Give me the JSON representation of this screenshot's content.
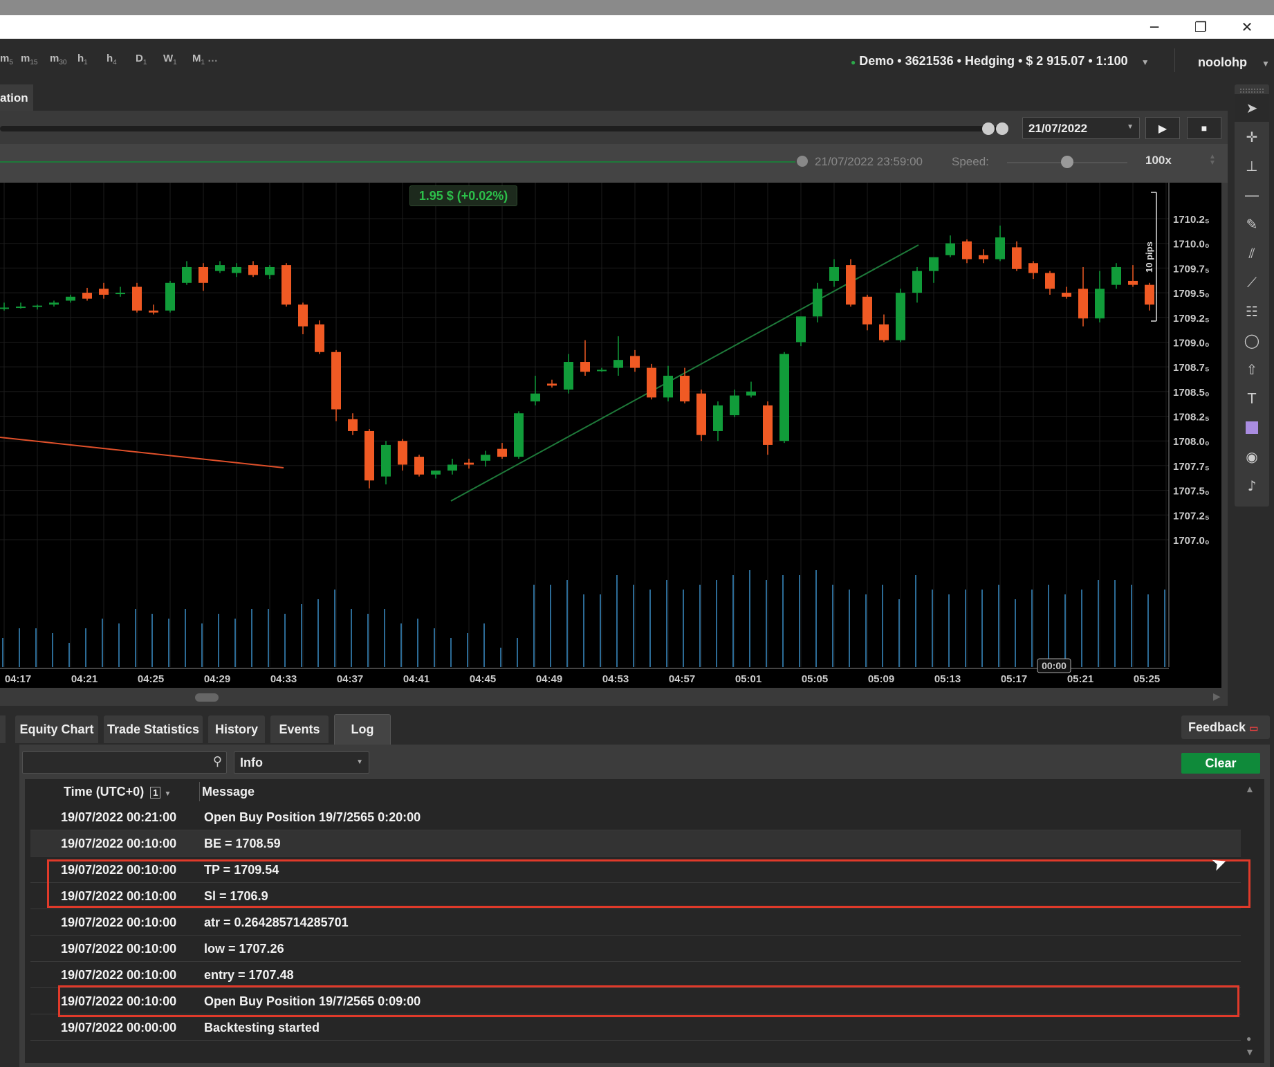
{
  "window": {
    "minimize": "─",
    "restore": "❐",
    "close": "✕"
  },
  "timeframes": [
    {
      "main": "m",
      "sub": "5"
    },
    {
      "main": "m",
      "sub": "15"
    },
    {
      "main": "m",
      "sub": "30"
    },
    {
      "main": "h",
      "sub": "1"
    },
    {
      "main": "h",
      "sub": "4"
    },
    {
      "main": "D",
      "sub": "1"
    },
    {
      "main": "W",
      "sub": "1"
    },
    {
      "main": "M",
      "sub": "1"
    }
  ],
  "more": "…",
  "account": {
    "status_color": "#2ca84a",
    "text": "Demo • 3621536 • Hedging • $ 2 915.07 • 1:100",
    "user": "noolohp"
  },
  "tab": {
    "label": "ation"
  },
  "controls": {
    "date": "21/07/2022",
    "end_time": "21/07/2022 23:59:00",
    "speed_label": "Speed:",
    "speed_value": "100x",
    "speed_level": 0.5
  },
  "chart_data": {
    "type": "candlestick",
    "profit_label": "1.95 $ (+0.02%)",
    "pips_label": "10 pips",
    "y_ticks": [
      "1710.2₅",
      "1710.0₀",
      "1709.7₅",
      "1709.5₀",
      "1709.2₅",
      "1709.0₀",
      "1708.7₅",
      "1708.5₀",
      "1708.2₅",
      "1708.0₀",
      "1707.7₅",
      "1707.5₀",
      "1707.2₅",
      "1707.0₀"
    ],
    "y_values": [
      1710.25,
      1710.0,
      1709.75,
      1709.5,
      1709.25,
      1709.0,
      1708.75,
      1708.5,
      1708.25,
      1708.0,
      1707.75,
      1707.5,
      1707.25,
      1707.0
    ],
    "x_ticks": [
      "04:17",
      "04:21",
      "04:25",
      "04:29",
      "04:33",
      "04:37",
      "04:41",
      "04:45",
      "04:49",
      "04:53",
      "04:57",
      "05:01",
      "05:05",
      "05:09",
      "05:13",
      "05:17",
      "05:21",
      "05:25"
    ],
    "cursor_time": "00:00",
    "candles": [
      [
        1709.35,
        1709.4,
        1709.32,
        1709.35
      ],
      [
        1709.36,
        1709.4,
        1709.34,
        1709.36
      ],
      [
        1709.36,
        1709.38,
        1709.33,
        1709.37
      ],
      [
        1709.38,
        1709.42,
        1709.36,
        1709.4
      ],
      [
        1709.42,
        1709.48,
        1709.4,
        1709.46
      ],
      [
        1709.5,
        1709.55,
        1709.42,
        1709.44
      ],
      [
        1709.54,
        1709.6,
        1709.44,
        1709.48
      ],
      [
        1709.5,
        1709.56,
        1709.46,
        1709.5
      ],
      [
        1709.56,
        1709.6,
        1709.3,
        1709.32
      ],
      [
        1709.32,
        1709.38,
        1709.28,
        1709.3
      ],
      [
        1709.32,
        1709.62,
        1709.3,
        1709.6
      ],
      [
        1709.6,
        1709.82,
        1709.58,
        1709.76
      ],
      [
        1709.76,
        1709.8,
        1709.52,
        1709.6
      ],
      [
        1709.72,
        1709.82,
        1709.7,
        1709.78
      ],
      [
        1709.7,
        1709.8,
        1709.66,
        1709.76
      ],
      [
        1709.78,
        1709.82,
        1709.66,
        1709.68
      ],
      [
        1709.68,
        1709.78,
        1709.64,
        1709.76
      ],
      [
        1709.78,
        1709.8,
        1709.36,
        1709.38
      ],
      [
        1709.38,
        1709.4,
        1709.08,
        1709.16
      ],
      [
        1709.18,
        1709.22,
        1708.88,
        1708.9
      ],
      [
        1708.9,
        1708.92,
        1708.2,
        1708.32
      ],
      [
        1708.22,
        1708.28,
        1708.06,
        1708.1
      ],
      [
        1708.1,
        1708.12,
        1707.52,
        1707.6
      ],
      [
        1707.64,
        1708.0,
        1707.56,
        1707.96
      ],
      [
        1708.0,
        1708.02,
        1707.7,
        1707.76
      ],
      [
        1707.84,
        1707.86,
        1707.64,
        1707.66
      ],
      [
        1707.66,
        1707.7,
        1707.62,
        1707.7
      ],
      [
        1707.7,
        1707.82,
        1707.66,
        1707.76
      ],
      [
        1707.78,
        1707.82,
        1707.72,
        1707.76
      ],
      [
        1707.8,
        1707.9,
        1707.74,
        1707.86
      ],
      [
        1707.92,
        1707.98,
        1707.82,
        1707.84
      ],
      [
        1707.84,
        1708.3,
        1707.82,
        1708.28
      ],
      [
        1708.4,
        1708.66,
        1708.36,
        1708.48
      ],
      [
        1708.58,
        1708.62,
        1708.54,
        1708.56
      ],
      [
        1708.52,
        1708.88,
        1708.48,
        1708.8
      ],
      [
        1708.8,
        1709.02,
        1708.66,
        1708.7
      ],
      [
        1708.72,
        1708.74,
        1708.7,
        1708.72
      ],
      [
        1708.74,
        1709.06,
        1708.66,
        1708.82
      ],
      [
        1708.86,
        1708.92,
        1708.7,
        1708.74
      ],
      [
        1708.74,
        1708.78,
        1708.42,
        1708.44
      ],
      [
        1708.44,
        1708.76,
        1708.4,
        1708.66
      ],
      [
        1708.66,
        1708.74,
        1708.38,
        1708.4
      ],
      [
        1708.48,
        1708.52,
        1708.0,
        1708.06
      ],
      [
        1708.1,
        1708.4,
        1708.0,
        1708.36
      ],
      [
        1708.26,
        1708.52,
        1708.24,
        1708.46
      ],
      [
        1708.46,
        1708.6,
        1708.44,
        1708.5
      ],
      [
        1708.36,
        1708.4,
        1707.86,
        1707.96
      ],
      [
        1708.0,
        1708.9,
        1707.98,
        1708.88
      ],
      [
        1709.0,
        1709.26,
        1708.96,
        1709.26
      ],
      [
        1709.26,
        1709.6,
        1709.2,
        1709.54
      ],
      [
        1709.62,
        1709.84,
        1709.56,
        1709.76
      ],
      [
        1709.78,
        1709.84,
        1709.36,
        1709.38
      ],
      [
        1709.46,
        1709.48,
        1709.12,
        1709.18
      ],
      [
        1709.18,
        1709.28,
        1709.0,
        1709.02
      ],
      [
        1709.02,
        1709.54,
        1709.0,
        1709.5
      ],
      [
        1709.5,
        1709.76,
        1709.4,
        1709.72
      ],
      [
        1709.72,
        1709.82,
        1709.6,
        1709.86
      ],
      [
        1709.88,
        1710.08,
        1709.86,
        1710.0
      ],
      [
        1710.02,
        1710.04,
        1709.8,
        1709.84
      ],
      [
        1709.88,
        1709.94,
        1709.8,
        1709.84
      ],
      [
        1709.84,
        1710.18,
        1709.82,
        1710.06
      ],
      [
        1709.96,
        1710.02,
        1709.72,
        1709.74
      ],
      [
        1709.8,
        1709.82,
        1709.64,
        1709.7
      ],
      [
        1709.7,
        1709.72,
        1709.48,
        1709.54
      ],
      [
        1709.5,
        1709.56,
        1709.44,
        1709.46
      ],
      [
        1709.54,
        1709.76,
        1709.16,
        1709.24
      ],
      [
        1709.24,
        1709.72,
        1709.2,
        1709.54
      ],
      [
        1709.58,
        1709.8,
        1709.54,
        1709.76
      ],
      [
        1709.62,
        1709.78,
        1709.56,
        1709.58
      ],
      [
        1709.58,
        1709.6,
        1709.32,
        1709.38
      ],
      [
        1709.28,
        1709.5,
        1709.24,
        1709.46
      ],
      [
        1709.46,
        1709.92,
        1709.42,
        1709.78
      ],
      [
        1709.78,
        1709.82,
        1709.2,
        1709.66
      ]
    ],
    "volumes": [
      0.3,
      0.4,
      0.4,
      0.35,
      0.25,
      0.4,
      0.5,
      0.45,
      0.6,
      0.55,
      0.5,
      0.6,
      0.45,
      0.55,
      0.5,
      0.6,
      0.6,
      0.55,
      0.65,
      0.7,
      0.8,
      0.6,
      0.55,
      0.6,
      0.45,
      0.5,
      0.4,
      0.3,
      0.35,
      0.45,
      0.2,
      0.3,
      0.85,
      0.85,
      0.9,
      0.75,
      0.75,
      0.95,
      0.85,
      0.8,
      0.9,
      0.8,
      0.85,
      0.9,
      0.95,
      1.0,
      0.9,
      0.95,
      0.95,
      1.0,
      0.85,
      0.8,
      0.75,
      0.85,
      0.7,
      0.95,
      0.8,
      0.75,
      0.8,
      0.8,
      0.85,
      0.7,
      0.8,
      0.85,
      0.75,
      0.8,
      0.9,
      0.9,
      0.85,
      0.75,
      0.8,
      0.85,
      0.95
    ]
  },
  "bottom_tabs": [
    "Equity Chart",
    "Trade Statistics",
    "History",
    "Events",
    "Log"
  ],
  "feedback": "Feedback",
  "log": {
    "level": "Info",
    "clear": "Clear",
    "col_time": "Time (UTC+0)",
    "col_badge": "1",
    "col_message": "Message",
    "rows": [
      {
        "time": "19/07/2022 00:21:00",
        "message": "Open Buy Position 19/7/2565 0:20:00"
      },
      {
        "time": "19/07/2022 00:10:00",
        "message": "BE = 1708.59"
      },
      {
        "time": "19/07/2022 00:10:00",
        "message": "TP = 1709.54"
      },
      {
        "time": "19/07/2022 00:10:00",
        "message": "Sl = 1706.9"
      },
      {
        "time": "19/07/2022 00:10:00",
        "message": "atr = 0.264285714285701"
      },
      {
        "time": "19/07/2022 00:10:00",
        "message": "low = 1707.26"
      },
      {
        "time": "19/07/2022 00:10:00",
        "message": "entry = 1707.48"
      },
      {
        "time": "19/07/2022 00:10:00",
        "message": "Open Buy Position 19/7/2565 0:09:00"
      },
      {
        "time": "19/07/2022 00:00:00",
        "message": "Backtesting started"
      }
    ]
  },
  "colors": {
    "bull": "#119c3a",
    "bear": "#f05a24",
    "trend": "#1e7a3a",
    "line_red": "#e0502a",
    "volume": "#3a8fc9",
    "highlight": "#e03a2a",
    "clear": "#0f8a3a"
  }
}
